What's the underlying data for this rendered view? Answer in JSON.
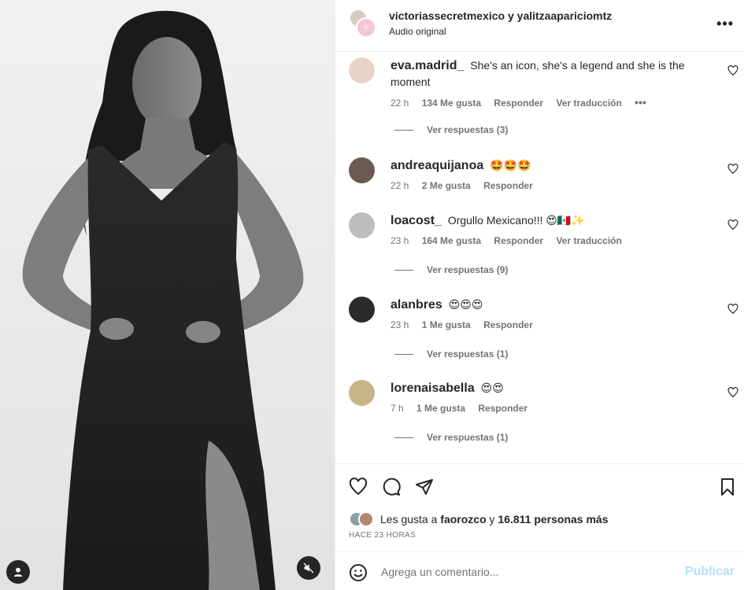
{
  "header": {
    "title": "victoriassecretmexico y yalitzaapariciomtz",
    "subtitle": "Audio original",
    "more_icon": "more-horizontal-icon"
  },
  "comments": [
    {
      "user": "eva.madrid_",
      "text": "She's an icon, she's a legend and she is the moment",
      "time": "22 h",
      "likes": "134 Me gusta",
      "reply": "Responder",
      "translate": "Ver traducción",
      "replies": "Ver respuestas (3)",
      "avatar_color": "#e9d3c9"
    },
    {
      "user": "andreaquijanoa",
      "text": "🤩🤩🤩",
      "time": "22 h",
      "likes": "2 Me gusta",
      "reply": "Responder",
      "avatar_color": "#6a5a4f"
    },
    {
      "user": "loacost_",
      "text": "Orgullo Mexicano!!! 😍🇲🇽✨",
      "time": "23 h",
      "likes": "164 Me gusta",
      "reply": "Responder",
      "translate": "Ver traducción",
      "replies": "Ver respuestas (9)",
      "avatar_color": "#bdbdbd"
    },
    {
      "user": "alanbres",
      "text": "😍😍😍",
      "time": "23 h",
      "likes": "1 Me gusta",
      "reply": "Responder",
      "replies": "Ver respuestas (1)",
      "avatar_color": "#2b2b2b"
    },
    {
      "user": "lorenaisabella",
      "text": "😍😍",
      "time": "7 h",
      "likes": "1 Me gusta",
      "reply": "Responder",
      "replies": "Ver respuestas (1)",
      "avatar_color": "#c9b48a"
    }
  ],
  "actions": {
    "like_icon": "heart-icon",
    "comment_icon": "comment-icon",
    "share_icon": "send-icon",
    "save_icon": "bookmark-icon"
  },
  "likes": {
    "prefix": "Les gusta a",
    "user": "faorozco",
    "middle": "y",
    "count": "16.811 personas más"
  },
  "timestamp": "HACE 23 HORAS",
  "composer": {
    "placeholder": "Agrega un comentario...",
    "publish": "Publicar"
  },
  "colors": {
    "text": "#262626",
    "secondary": "#737373",
    "publish_disabled": "#b2dffc",
    "border": "#efefef"
  }
}
